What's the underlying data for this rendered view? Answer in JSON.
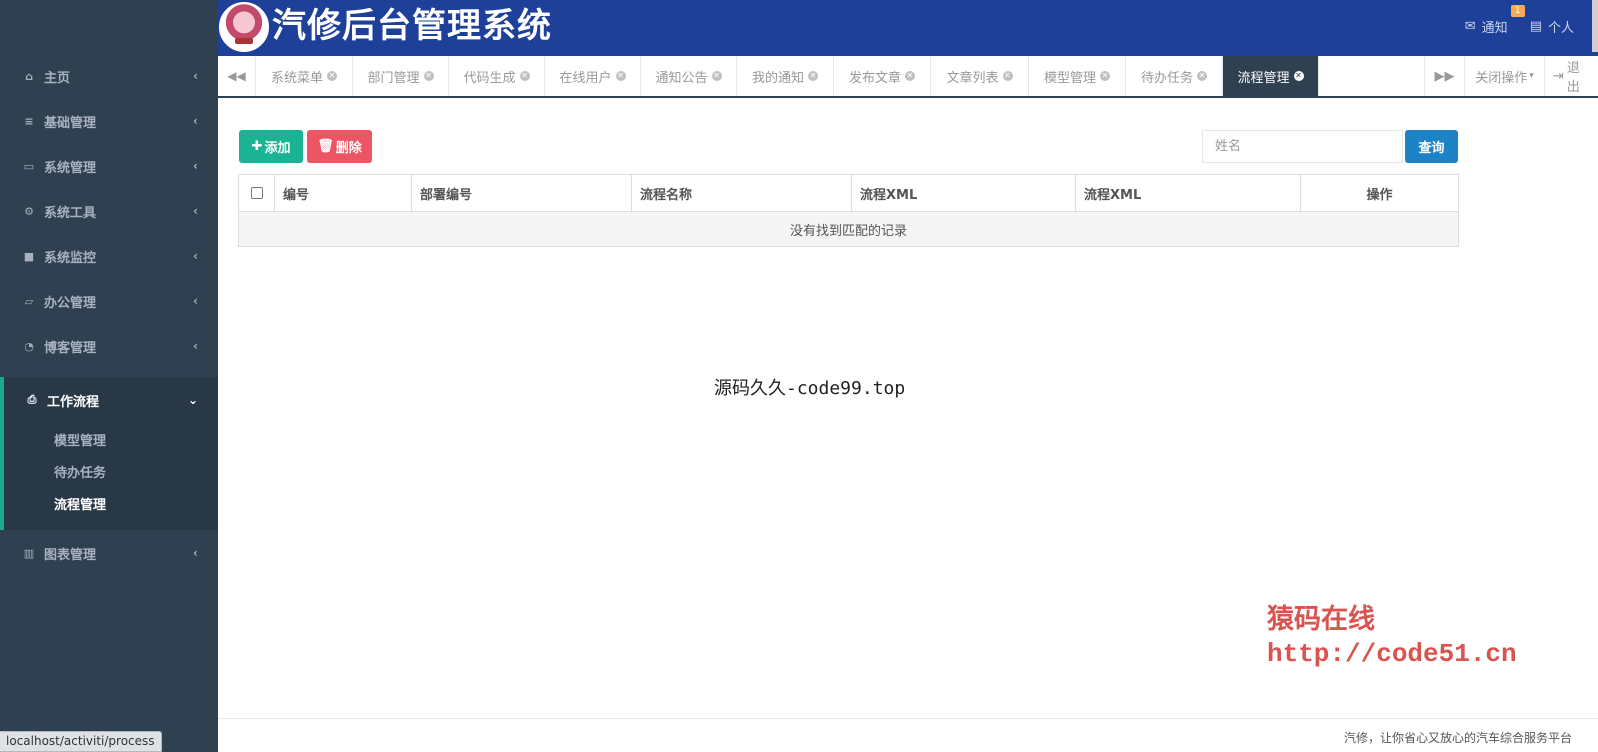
{
  "header": {
    "app_title": "汽修后台管理系统",
    "notify_label": "通知",
    "notify_badge": "1",
    "personal_label": "个人"
  },
  "sidebar": {
    "items": [
      {
        "label": "主页",
        "icon": "home-icon"
      },
      {
        "label": "基础管理",
        "icon": "list-icon"
      },
      {
        "label": "系统管理",
        "icon": "desktop-icon"
      },
      {
        "label": "系统工具",
        "icon": "gear-icon"
      },
      {
        "label": "系统监控",
        "icon": "video-camera-icon"
      },
      {
        "label": "办公管理",
        "icon": "laptop-icon"
      },
      {
        "label": "博客管理",
        "icon": "rss-icon"
      }
    ],
    "open_group": {
      "label": "工作流程",
      "icon": "print-icon",
      "children": [
        "模型管理",
        "待办任务",
        "流程管理"
      ],
      "active_child": "流程管理"
    },
    "after_items": [
      {
        "label": "图表管理",
        "icon": "bar-chart-icon"
      }
    ]
  },
  "tabs": {
    "items": [
      "系统菜单",
      "部门管理",
      "代码生成",
      "在线用户",
      "通知公告",
      "我的通知",
      "发布文章",
      "文章列表",
      "模型管理",
      "待办任务",
      "流程管理"
    ],
    "active": "流程管理",
    "close_ops_label": "关闭操作",
    "logout_label": "退出"
  },
  "toolbar": {
    "add_label": "添加",
    "delete_label": "删除",
    "search_placeholder": "姓名",
    "query_label": "查询"
  },
  "table": {
    "columns": [
      "编号",
      "部署编号",
      "流程名称",
      "流程XML",
      "流程XML",
      "操作"
    ],
    "empty_text": "没有找到匹配的记录"
  },
  "watermarks": {
    "center": "源码久久-code99.top",
    "red_line1": "猿码在线",
    "red_line2": "http://code51.cn"
  },
  "footer": {
    "text": "汽修，让你省心又放心的汽车综合服务平台"
  },
  "status_bar": {
    "url": "localhost/activiti/process"
  },
  "colors": {
    "sidebar_bg": "#2f4050",
    "header_bg": "#1e4099",
    "accent_green": "#1ab394",
    "danger_red": "#ed5565",
    "primary_blue": "#1c84c6"
  }
}
